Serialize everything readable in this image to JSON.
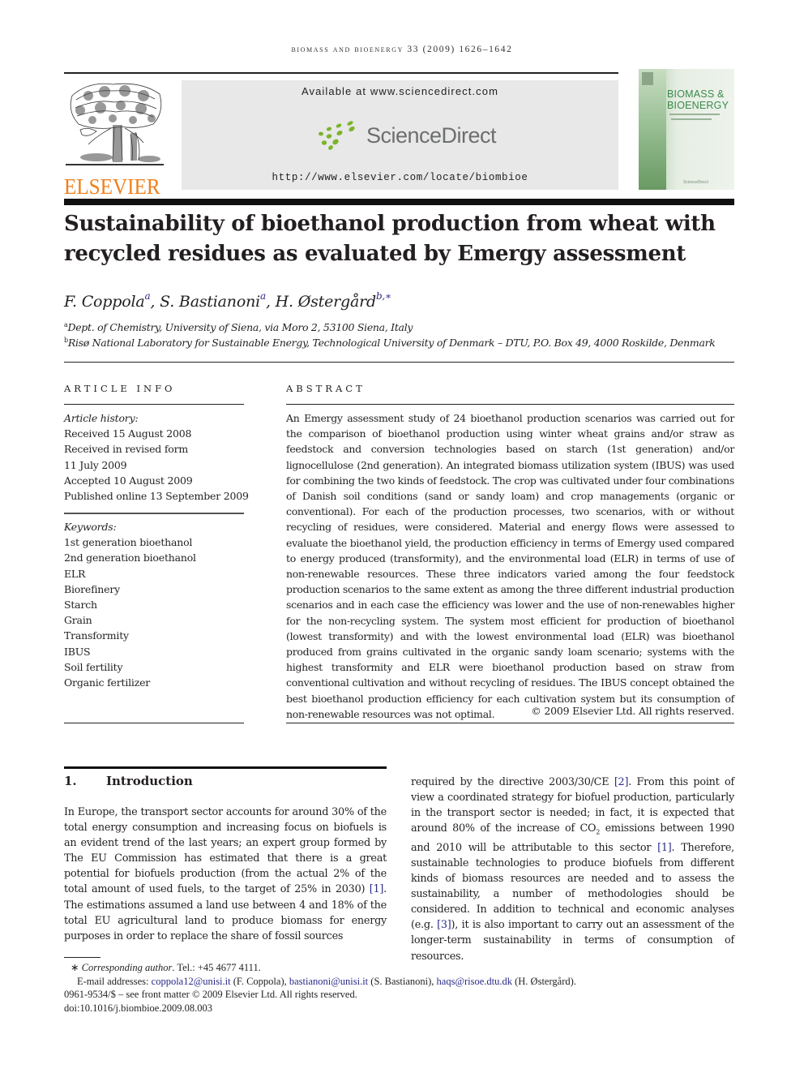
{
  "header": {
    "running_head": "biomass and bioenergy 33 (2009) 1626–1642",
    "publisher_logo_text": "ELSEVIER",
    "sciencedirect": {
      "available_text": "Available at www.sciencedirect.com",
      "logo_text": "ScienceDirect",
      "url": "http://www.elsevier.com/locate/biombioe"
    },
    "cover": {
      "title_line1": "BIOMASS &",
      "title_line2": "BIOENERGY",
      "footer": "ScienceDirect"
    }
  },
  "article": {
    "title": "Sustainability of bioethanol production from wheat with recycled residues as evaluated by Emergy assessment",
    "authors": [
      {
        "name": "F. Coppola",
        "affil": "a"
      },
      {
        "name": "S. Bastianoni",
        "affil": "a"
      },
      {
        "name": "H. Østergård",
        "affil": "b,∗"
      }
    ],
    "affiliations": [
      {
        "key": "a",
        "text": "Dept. of Chemistry, University of Siena, via Moro 2, 53100 Siena, Italy"
      },
      {
        "key": "b",
        "text": "Risø National Laboratory for Sustainable Energy, Technological University of Denmark – DTU, P.O. Box 49, 4000 Roskilde, Denmark"
      }
    ]
  },
  "article_info": {
    "heading": "ARTICLE INFO",
    "history_label": "Article history:",
    "history": [
      "Received 15 August 2008",
      "Received in revised form",
      "11 July 2009",
      "Accepted 10 August 2009",
      "Published online 13 September 2009"
    ],
    "keywords_label": "Keywords:",
    "keywords": [
      "1st generation bioethanol",
      "2nd generation bioethanol",
      "ELR",
      "Biorefinery",
      "Starch",
      "Grain",
      "Transformity",
      "IBUS",
      "Soil fertility",
      "Organic fertilizer"
    ]
  },
  "abstract": {
    "heading": "ABSTRACT",
    "text": "An Emergy assessment study of 24 bioethanol production scenarios was carried out for the comparison of bioethanol production using winter wheat grains and/or straw as feedstock and conversion technologies based on starch (1st generation) and/or lignocellulose (2nd generation). An integrated biomass utilization system (IBUS) was used for combining the two kinds of feedstock. The crop was cultivated under four combinations of Danish soil conditions (sand or sandy loam) and crop managements (organic or conventional). For each of the production processes, two scenarios, with or without recycling of residues, were considered. Material and energy flows were assessed to evaluate the bioethanol yield, the production efficiency in terms of Emergy used compared to energy produced (transformity), and the environmental load (ELR) in terms of use of non-renewable resources. These three indicators varied among the four feedstock production scenarios to the same extent as among the three different industrial production scenarios and in each case the efficiency was lower and the use of non-renewables higher for the non-recycling system. The system most efficient for production of bioethanol (lowest transformity) and with the lowest environmental load (ELR) was bioethanol produced from grains cultivated in the organic sandy loam scenario; systems with the highest transformity and ELR were bioethanol production based on straw from conventional cultivation and without recycling of residues. The IBUS concept obtained the best bioethanol production efficiency for each cultivation system but its consumption of non-renewable resources was not optimal.",
    "copyright": "© 2009 Elsevier Ltd. All rights reserved."
  },
  "introduction": {
    "number": "1.",
    "heading": "Introduction",
    "left": {
      "p1": "In Europe, the transport sector accounts for around 30% of the total energy consumption and increasing focus on biofuels is an evident trend of the last years; an expert group formed by The EU Commission has estimated that there is a great potential for biofuels production (from the actual 2% of the total amount of used fuels, to the target of 25% in 2030) ",
      "ref1": "[1]",
      "p2": ". The estimations assumed a land use between 4 and 18% of the total EU agricultural land to produce biomass for energy purposes in order to replace the share of fossil sources"
    },
    "right": {
      "s1": "required by the directive 2003/30/CE ",
      "ref2": "[2]",
      "s2": ". From this point of view a coordinated strategy for biofuel production, particularly in the transport sector is needed; in fact, it is expected that around 80% of the increase of CO",
      "sub": "2",
      "s3": " emissions between 1990 and 2010 will be attributable to this sector ",
      "ref1": "[1]",
      "s4": ". Therefore, sustainable technologies to produce biofuels from different kinds of biomass resources are needed and to assess the sustainability, a number of methodologies should be considered. In addition to technical and economic analyses (e.g. ",
      "ref3": "[3]",
      "s5": "), it is also important to carry out an assessment of the longer-term sustainability in terms of consumption of resources."
    }
  },
  "footnotes": {
    "corr_star": "∗",
    "corr_label": "Corresponding author",
    "corr_tel": ". Tel.: +45 4677 4111.",
    "email_label": "E-mail addresses: ",
    "emails": [
      {
        "addr": "coppola12@unisi.it",
        "who": " (F. Coppola), "
      },
      {
        "addr": "bastianoni@unisi.it",
        "who": " (S. Bastianoni), "
      },
      {
        "addr": "haqs@risoe.dtu.dk",
        "who": " (H. Østergård)."
      }
    ],
    "issn": "0961-9534/$ – see front matter © 2009 Elsevier Ltd. All rights reserved.",
    "doi": "doi:10.1016/j.biombioe.2009.08.003"
  }
}
